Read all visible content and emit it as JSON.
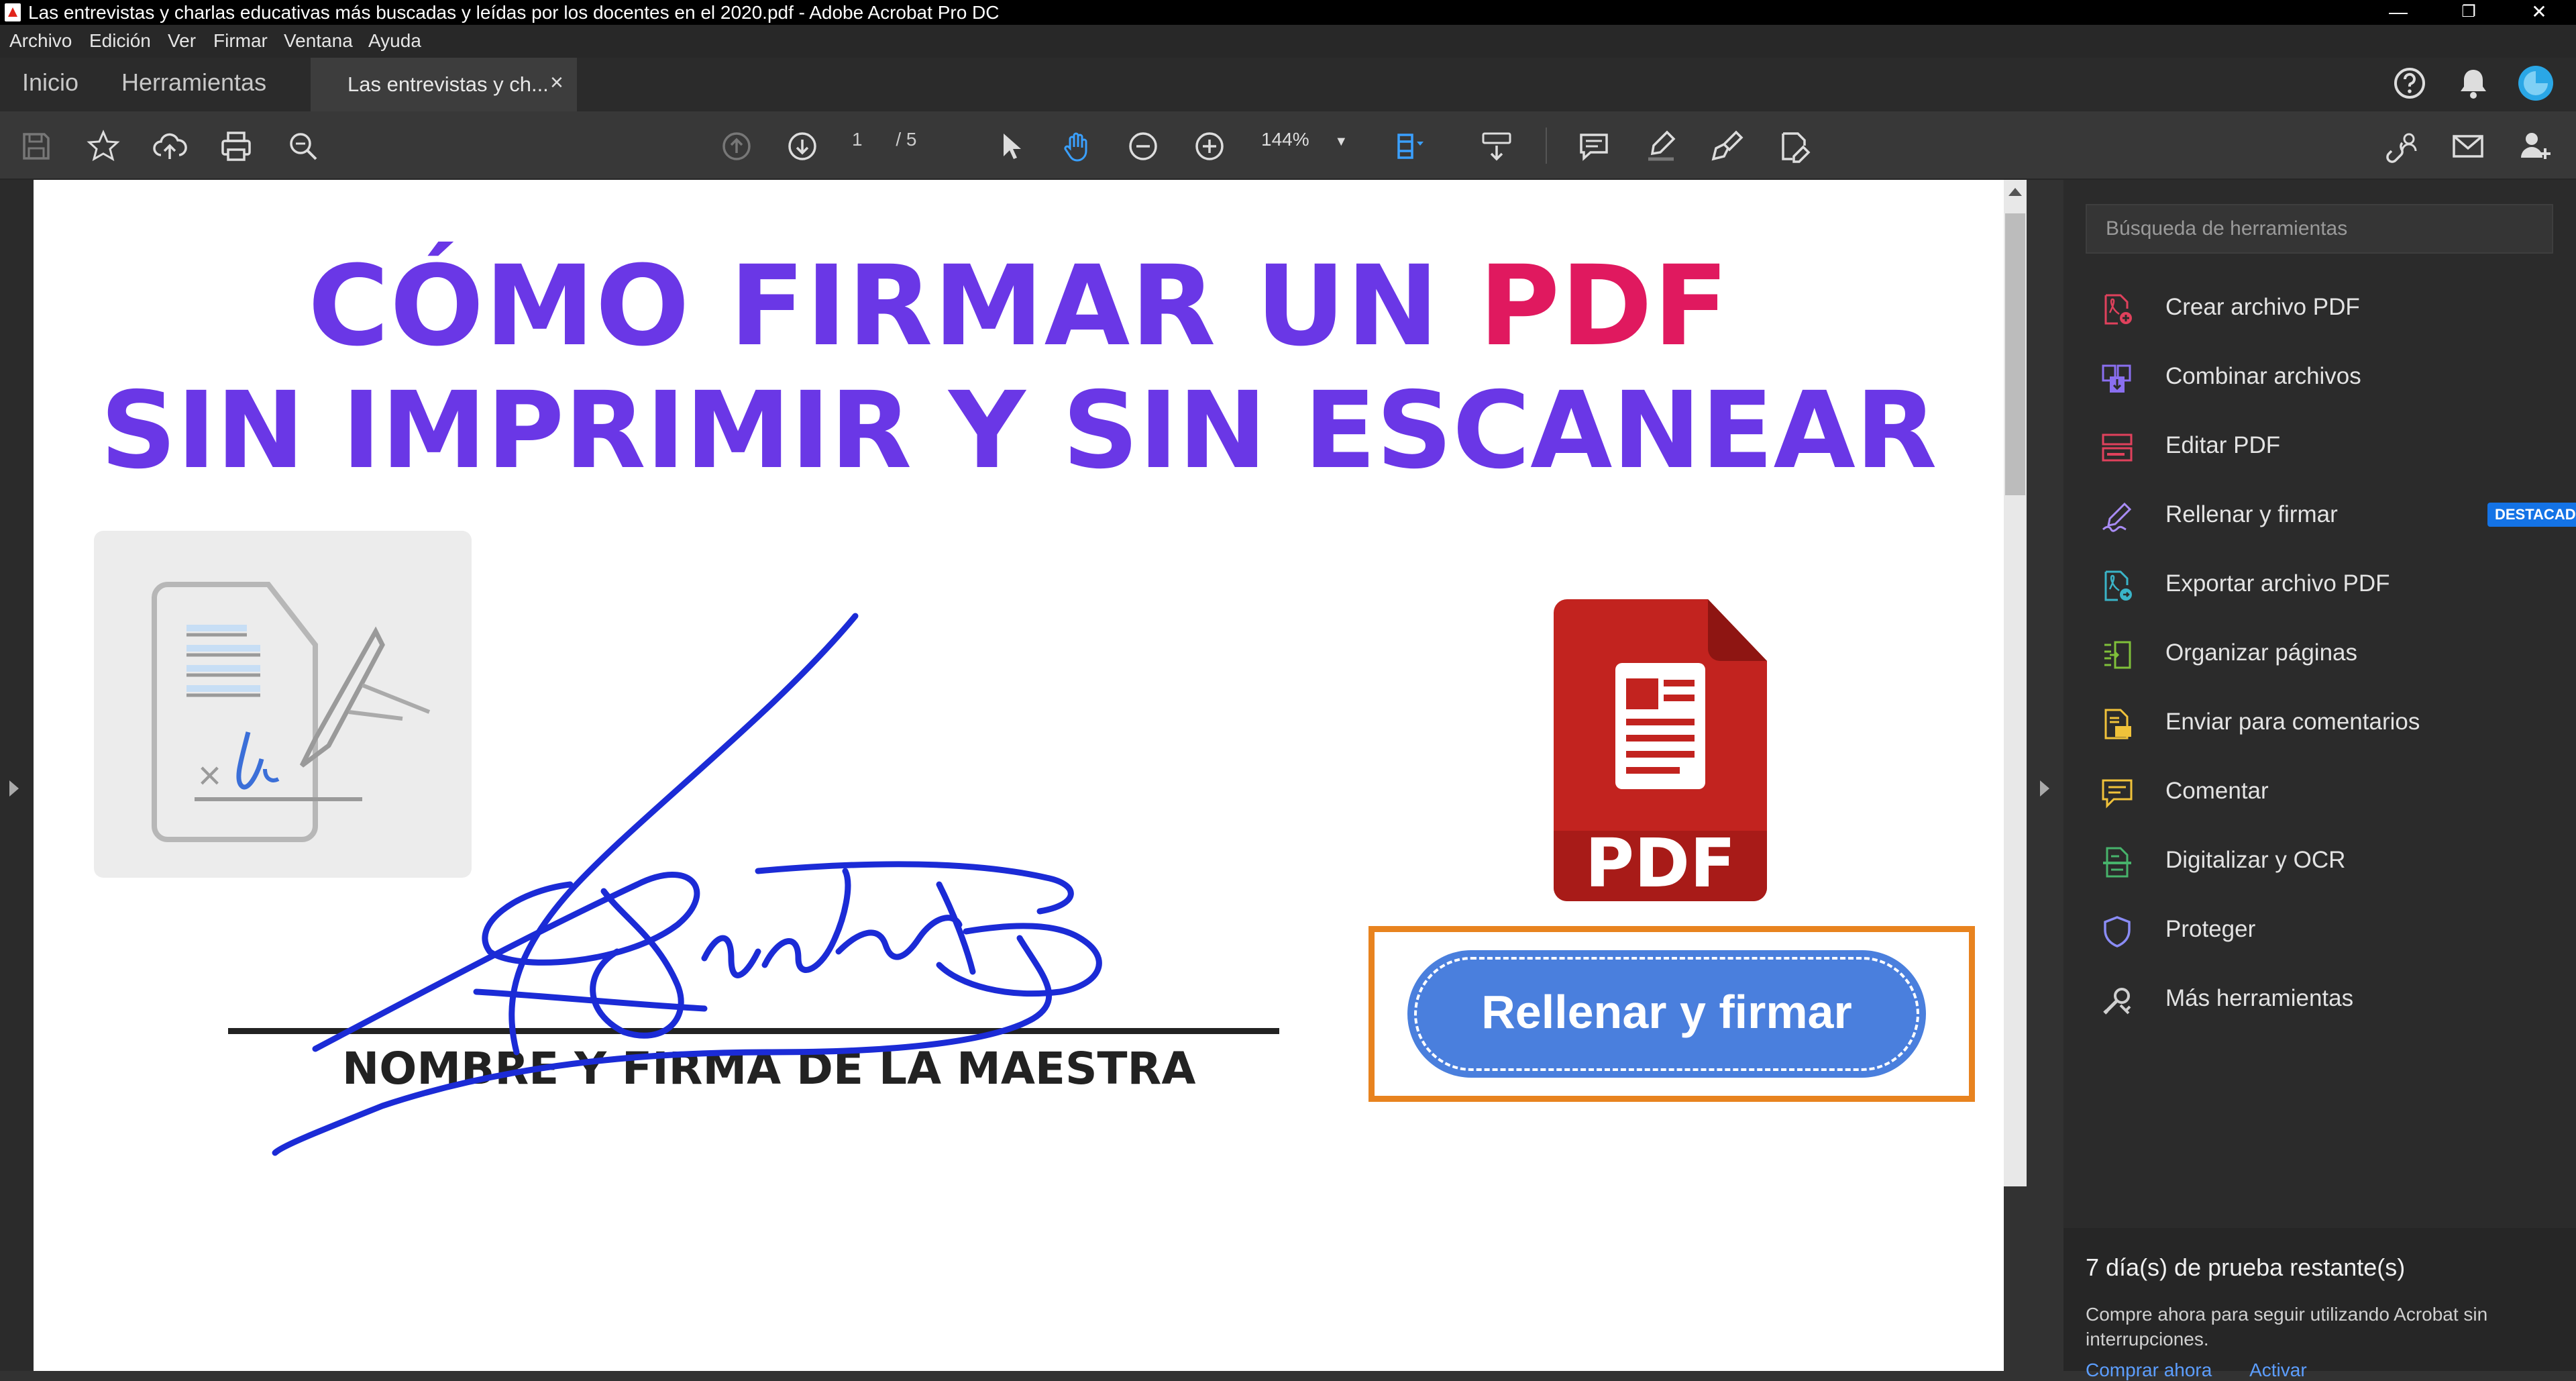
{
  "window": {
    "title": "Las entrevistas y charlas educativas más buscadas y leídas por los docentes en el 2020.pdf - Adobe Acrobat Pro DC",
    "minimize": "—",
    "restore": "❐",
    "close": "✕"
  },
  "menu": [
    "Archivo",
    "Edición",
    "Ver",
    "Firmar",
    "Ventana",
    "Ayuda"
  ],
  "tabs": {
    "home": "Inicio",
    "tools": "Herramientas",
    "document": "Las entrevistas y ch...",
    "close": "×"
  },
  "toolbar": {
    "current_page": "1",
    "page_total": "/ 5",
    "zoom": "144%"
  },
  "document": {
    "title_line1": "CÓMO FIRMAR UN ",
    "title_line1_highlight": "PDF",
    "title_line2": "SIN IMPRIMIR Y SIN ESCANEAR",
    "illustration_mark": "×",
    "pdf_label": "PDF",
    "fill_sign_button": "Rellenar y firmar",
    "signature_caption": "NOMBRE Y FIRMA DE LA MAESTRA"
  },
  "tools_panel": {
    "search_placeholder": "Búsqueda de herramientas",
    "items": [
      {
        "label": "Crear archivo PDF",
        "icon": "create-pdf-icon",
        "color": "#e0415c"
      },
      {
        "label": "Combinar archivos",
        "icon": "combine-files-icon",
        "color": "#8a6ff0"
      },
      {
        "label": "Editar PDF",
        "icon": "edit-pdf-icon",
        "color": "#e0415c"
      },
      {
        "label": "Rellenar y firmar",
        "icon": "fill-sign-icon",
        "color": "#a98cf5",
        "badge": "DESTACADA"
      },
      {
        "label": "Exportar archivo PDF",
        "icon": "export-pdf-icon",
        "color": "#3ab4c8"
      },
      {
        "label": "Organizar páginas",
        "icon": "organize-pages-icon",
        "color": "#7fc03a"
      },
      {
        "label": "Enviar para comentarios",
        "icon": "send-comments-icon",
        "color": "#f0c23a"
      },
      {
        "label": "Comentar",
        "icon": "comment-icon",
        "color": "#f0c23a"
      },
      {
        "label": "Digitalizar y OCR",
        "icon": "scan-ocr-icon",
        "color": "#47b36b"
      },
      {
        "label": "Proteger",
        "icon": "protect-icon",
        "color": "#8a8cf5"
      },
      {
        "label": "Más herramientas",
        "icon": "more-tools-icon",
        "color": "#cfcfcf"
      }
    ],
    "trial_title": "7 día(s) de prueba restante(s)",
    "trial_desc": "Compre ahora para seguir utilizando Acrobat sin interrupciones.",
    "buy_link": "Comprar ahora",
    "activate_link": "Activar"
  }
}
